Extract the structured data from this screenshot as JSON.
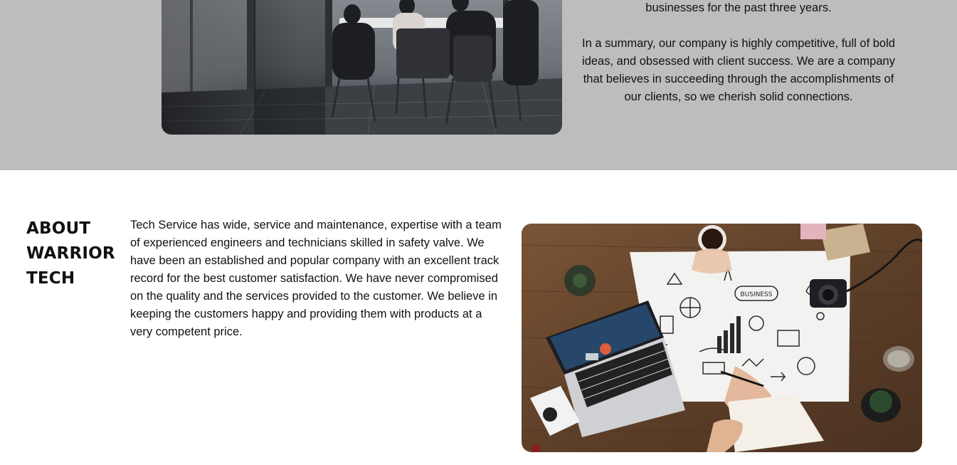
{
  "company_section": {
    "paragraph_tail": "businesses for the past three years.",
    "summary": "In a summary, our company is highly competitive, full of bold ideas, and obsessed with client success. We are a company that believes in succeeding through the accomplishments of our clients, so we cherish solid connections."
  },
  "about_section": {
    "title_lines": [
      "ABOUT",
      "WARRIOR",
      "TECH"
    ],
    "body": "Tech Service has wide, service and maintenance, expertise with a team of experienced engineers and technicians skilled in safety valve. We have been an established and popular company with an excellent track record for the best customer satisfaction. We have never compromised on the quality and the services provided to the customer. We believe in keeping the customers happy and providing them with products at a very competent price.",
    "image_text": "BUSINESS"
  },
  "colors": {
    "band_background": "#bdbdbd",
    "page_background": "#ffffff",
    "text": "#111111",
    "desk_wood": "#6b4a2f"
  }
}
